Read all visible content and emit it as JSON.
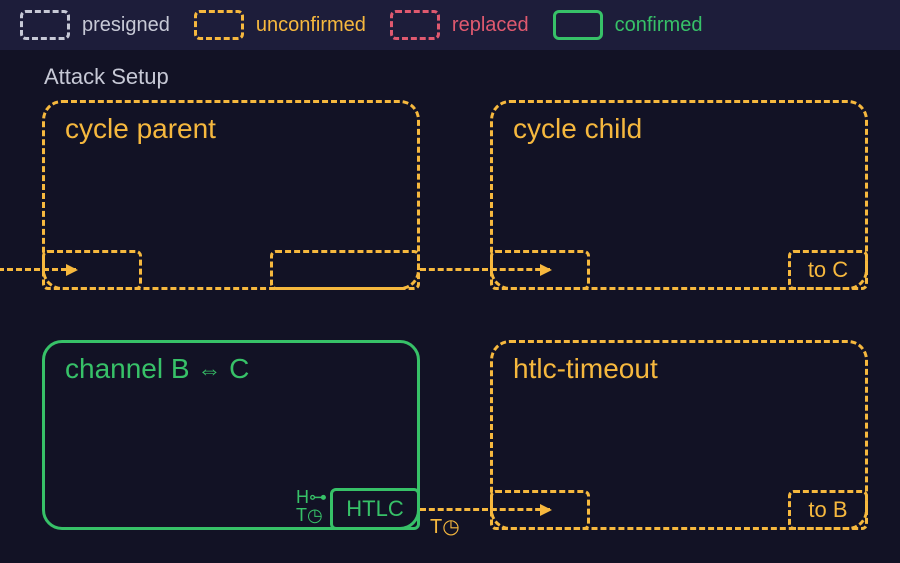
{
  "legend": {
    "items": [
      {
        "label": "presigned",
        "style": "dashed",
        "color": "gray"
      },
      {
        "label": "unconfirmed",
        "style": "dashed",
        "color": "amber"
      },
      {
        "label": "replaced",
        "style": "dashed",
        "color": "red"
      },
      {
        "label": "confirmed",
        "style": "solid",
        "color": "green"
      }
    ]
  },
  "section": {
    "title": "Attack Setup"
  },
  "boxes": {
    "cycle_parent": {
      "title": "cycle parent"
    },
    "cycle_child": {
      "title": "cycle child",
      "out_label": "to C"
    },
    "channel_bc": {
      "title_pre": "channel B",
      "title_mid": "⇔",
      "title_post": "C",
      "htlc_label": "HTLC"
    },
    "htlc_timeout": {
      "title": "htlc-timeout",
      "out_label": "to B"
    }
  },
  "annotations": {
    "hash": "H⊶",
    "time": "T◷",
    "timeout_edge": "T◷"
  },
  "colors": {
    "amber": "#f6b83e",
    "green": "#37c168",
    "bg": "#121225"
  }
}
